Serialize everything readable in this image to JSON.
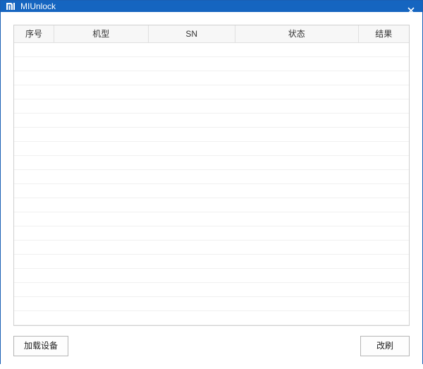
{
  "window": {
    "title": "MIUnlock"
  },
  "table": {
    "columns": {
      "index": "序号",
      "model": "机型",
      "sn": "SN",
      "status": "状态",
      "result": "结果"
    },
    "rows": []
  },
  "buttons": {
    "load_devices": "加载设备",
    "refresh": "改刷"
  }
}
